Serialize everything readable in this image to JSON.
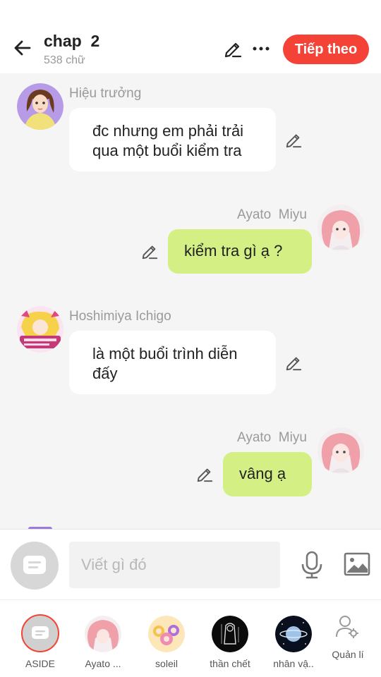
{
  "header": {
    "title": "chap  2",
    "subtitle": "538 chữ",
    "next_label": "Tiếp theo",
    "accent": "#f44336"
  },
  "messages": [
    {
      "side": "left",
      "name": "Hiệu trưởng",
      "line1": "đc nhưng em phải trải",
      "line2": "qua một buổi kiểm tra"
    },
    {
      "side": "right",
      "name": "Ayato  Miyu",
      "line1": "kiểm tra gì ạ ?"
    },
    {
      "side": "left",
      "name": "Hoshimiya Ichigo",
      "line1": "là một buổi trình diễn",
      "line2": "đấy"
    },
    {
      "side": "right",
      "name": "Ayato  Miyu",
      "line1": "vâng ạ"
    }
  ],
  "bubble_colors": {
    "left": "#ffffff",
    "right": "#d4f084"
  },
  "input": {
    "placeholder": "Viết gì đó",
    "value": ""
  },
  "characters": [
    {
      "label": "ASIDE",
      "icon": "aside-icon"
    },
    {
      "label": "Ayato ...",
      "icon": "avatar"
    },
    {
      "label": "soleil",
      "icon": "avatar"
    },
    {
      "label": "thần chết",
      "icon": "avatar"
    },
    {
      "label": "nhân vậ..",
      "icon": "avatar"
    },
    {
      "label": "Quản lí",
      "icon": "manage-user-icon"
    }
  ]
}
